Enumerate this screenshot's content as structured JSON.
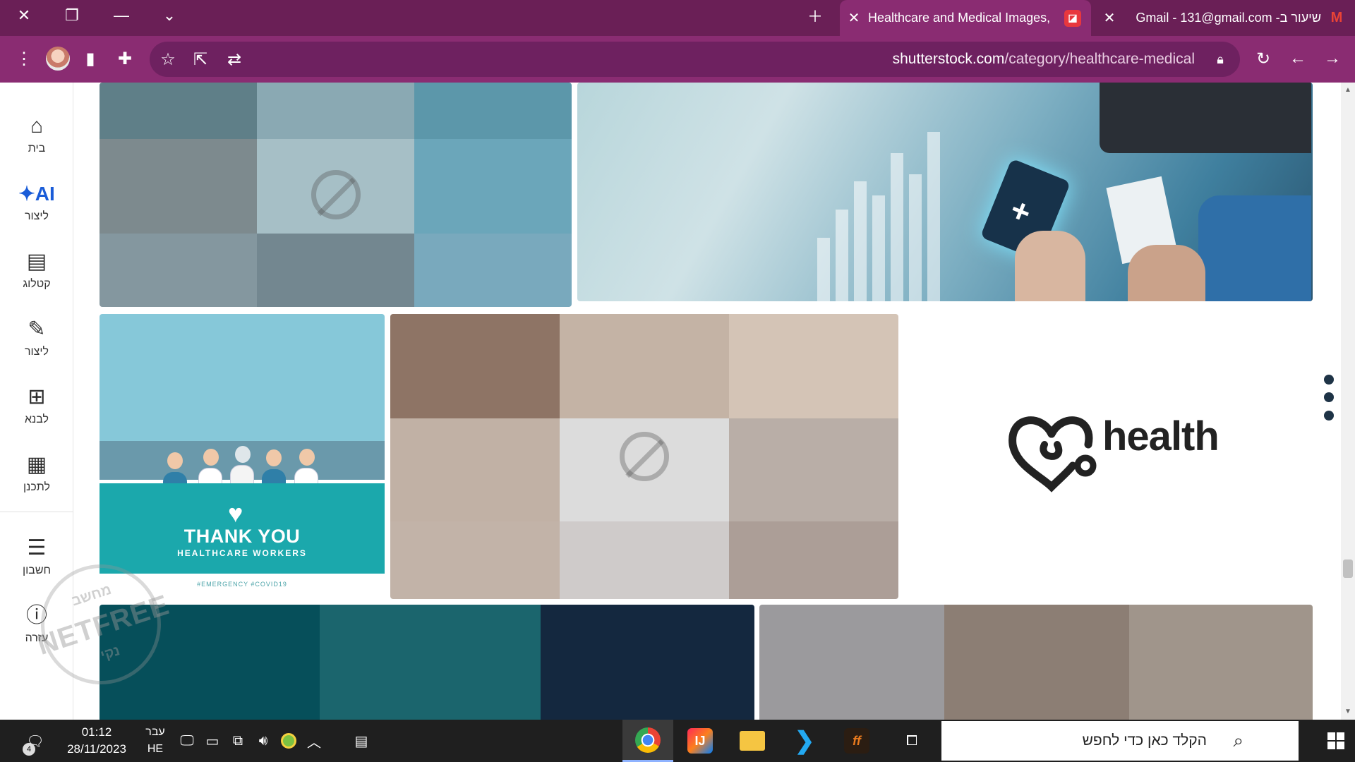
{
  "browser": {
    "tabs": [
      {
        "title": "Healthcare and Medical Images,",
        "active": true
      },
      {
        "title": "שיעור ב- Gmail - 131@gmail.com",
        "active": false
      }
    ],
    "url_domain": "shutterstock.com",
    "url_path": "/category/healthcare-medical",
    "accent_color": "#8a2c72",
    "titlebar_color": "#6a1f56"
  },
  "sidebar": {
    "items": [
      {
        "label": "בית",
        "icon": "home-icon"
      },
      {
        "label": "ליצור",
        "icon": "ai-sparkle-icon",
        "badge": "AI"
      },
      {
        "label": "קטלוג",
        "icon": "catalog-icon"
      },
      {
        "label": "ליצור",
        "icon": "edit-icon"
      },
      {
        "label": "לבנא",
        "icon": "templates-icon"
      },
      {
        "label": "לתכנן",
        "icon": "calendar-icon"
      },
      {
        "label": "חשבון",
        "icon": "list-icon"
      },
      {
        "label": "עזרה",
        "icon": "help-icon"
      }
    ]
  },
  "gallery": {
    "thanks_title": "THANK YOU",
    "thanks_sub": "HEALTHCARE WORKERS",
    "thanks_tags": "#EMERGENCY #COVID19",
    "health_logo": "health"
  },
  "watermark": {
    "top": "מחשב",
    "middle": "NETFREE",
    "bottom": "נקי"
  },
  "taskbar": {
    "time": "01:12",
    "date": "28/11/2023",
    "lang_top": "עבר",
    "lang_bottom": "HE",
    "notification_count": "4",
    "search_placeholder": "הקלד כאן כדי לחפש"
  }
}
